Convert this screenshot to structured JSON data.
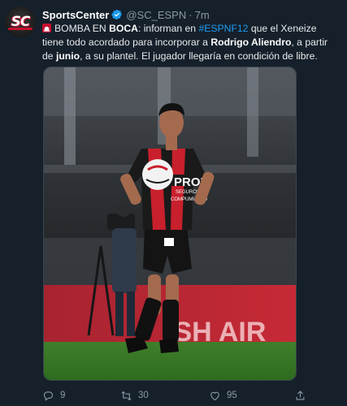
{
  "account": {
    "display_name": "SportsCenter",
    "handle": "@SC_ESPN",
    "separator": "·",
    "time": "7m",
    "avatar_text": "SC",
    "verified": true
  },
  "tweet": {
    "parts": [
      {
        "text": "BOMBA EN ",
        "style": "normal"
      },
      {
        "text": "BOCA",
        "style": "bold"
      },
      {
        "text": ": informan en ",
        "style": "normal"
      },
      {
        "text": "#ESPNF12",
        "style": "hashtag"
      },
      {
        "text": " que el Xeneize tiene todo acordado para incorporar a ",
        "style": "normal"
      },
      {
        "text": "Rodrigo Aliendro",
        "style": "bold"
      },
      {
        "text": ", a partir de ",
        "style": "normal"
      },
      {
        "text": "junio",
        "style": "bold"
      },
      {
        "text": ", a su plantel. El jugador llegaría en condición de libre.",
        "style": "normal"
      }
    ],
    "leading_icon": "siren-icon"
  },
  "media": {
    "jersey_sponsor_main": "PROF",
    "jersey_sponsor_sub": "SEGUROS",
    "jersey_sponsor_small": "COMPUMUNDO",
    "banner_text": "ISH AIR"
  },
  "actions": {
    "reply_count": "9",
    "retweet_count": "30",
    "like_count": "95"
  },
  "colors": {
    "background": "#15202b",
    "text": "#e7e9ea",
    "secondary": "#8b98a5",
    "link": "#1d9bf0",
    "verified": "#1d9bf0"
  }
}
